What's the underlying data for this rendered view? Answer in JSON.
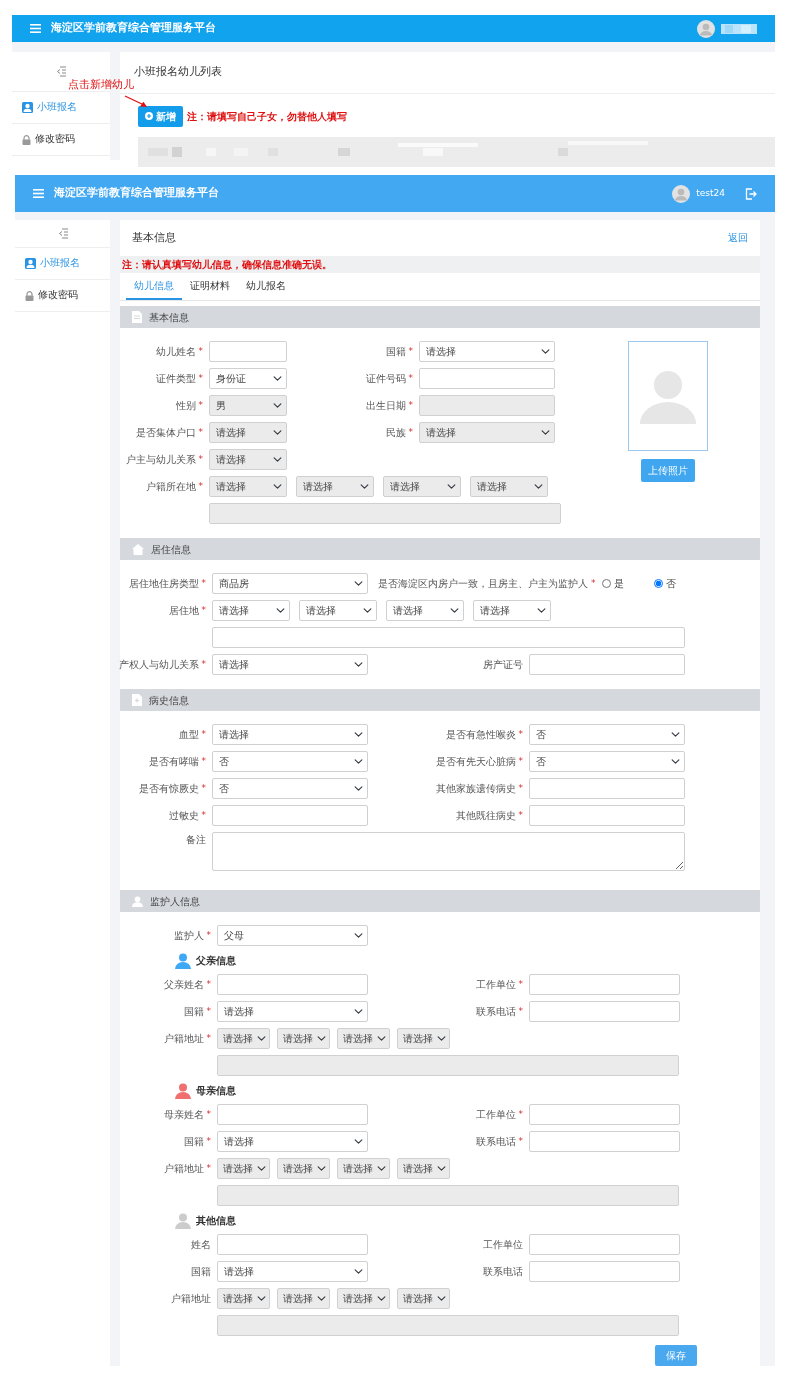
{
  "top_screen": {
    "app_title": "海淀区学前教育综合管理服务平台",
    "sidebar": [
      {
        "label": "小班报名",
        "selected": true
      },
      {
        "label": "修改密码",
        "selected": false
      }
    ],
    "page_title": "小班报名幼儿列表",
    "annotation": "点击新增幼儿",
    "add_button": "新增",
    "note": "注：请填写自己子女，勿替他人填写"
  },
  "form_screen": {
    "app_title": "海淀区学前教育综合管理服务平台",
    "username": "test24",
    "sidebar": [
      {
        "label": "小班报名",
        "selected": true
      },
      {
        "label": "修改密码",
        "selected": false
      }
    ],
    "card_title": "基本信息",
    "back_link": "返回",
    "note": "注：请认真填写幼儿信息，确保信息准确无误。",
    "tabs": [
      {
        "label": "幼儿信息",
        "selected": true
      },
      {
        "label": "证明材料",
        "selected": false
      },
      {
        "label": "幼儿报名",
        "selected": false
      }
    ],
    "sections": [
      {
        "title": "基本信息",
        "photo_button": "上传照片",
        "rows": [
          [
            {
              "kind": "input",
              "label": "幼儿姓名",
              "req": "*",
              "disabled": false
            },
            {
              "kind": "select",
              "label": "国籍",
              "req": "*",
              "value": "请选择",
              "disabled": false
            }
          ],
          [
            {
              "kind": "select",
              "label": "证件类型",
              "req": "*",
              "value": "身份证",
              "disabled": false
            },
            {
              "kind": "input",
              "label": "证件号码",
              "req": "*",
              "disabled": false
            }
          ],
          [
            {
              "kind": "select",
              "label": "性别",
              "req": "*",
              "value": "男",
              "disabled": true
            },
            {
              "kind": "input",
              "label": "出生日期",
              "req": "*",
              "disabled": true
            }
          ],
          [
            {
              "kind": "select",
              "label": "是否集体户口",
              "req": "*",
              "value": "请选择",
              "disabled": true
            },
            {
              "kind": "select",
              "label": "民族",
              "req": "*",
              "value": "请选择",
              "disabled": true
            }
          ],
          [
            {
              "kind": "select",
              "label": "户主与幼儿关系",
              "req": "*",
              "value": "请选择",
              "disabled": true
            }
          ],
          [
            {
              "kind": "address",
              "label": "户籍所在地",
              "req": "*",
              "values": [
                "请选择",
                "请选择",
                "请选择",
                "请选择"
              ],
              "disabled": true
            }
          ],
          [
            {
              "kind": "wide",
              "disabled": true
            }
          ]
        ]
      },
      {
        "title": "居住信息",
        "rows": [
          [
            {
              "kind": "select",
              "label": "居住地住房类型",
              "req": "*",
              "value": "商品房",
              "disabled": false
            },
            {
              "kind": "radio",
              "label": "是否海淀区内房户一致，且房主、户主为监护人",
              "req": "*",
              "choices": [
                {
                  "label": "是",
                  "selected": false
                },
                {
                  "label": "否",
                  "selected": true
                }
              ]
            }
          ],
          [
            {
              "kind": "address",
              "label": "居住地",
              "req": "*",
              "values": [
                "请选择",
                "请选择",
                "请选择",
                "请选择"
              ],
              "disabled": false
            }
          ],
          [
            {
              "kind": "wide",
              "disabled": false
            }
          ],
          [
            {
              "kind": "select",
              "label": "产权人与幼儿关系",
              "req": "*",
              "value": "请选择",
              "disabled": false
            },
            {
              "kind": "input",
              "label": "房产证号",
              "disabled": false
            }
          ]
        ]
      },
      {
        "title": "病史信息",
        "rows": [
          [
            {
              "kind": "select",
              "label": "血型",
              "req": "*",
              "value": "请选择",
              "disabled": false
            },
            {
              "kind": "select",
              "label": "是否有急性喉炎",
              "req": "*",
              "value": "否",
              "disabled": false
            }
          ],
          [
            {
              "kind": "select",
              "label": "是否有哮喘",
              "req": "*",
              "value": "否",
              "disabled": false
            },
            {
              "kind": "select",
              "label": "是否有先天心脏病",
              "req": "*",
              "value": "否",
              "disabled": false
            }
          ],
          [
            {
              "kind": "select",
              "label": "是否有惊厥史",
              "req": "*",
              "value": "否",
              "disabled": false
            },
            {
              "kind": "input",
              "label": "其他家族遗传病史",
              "req": "*",
              "disabled": false
            }
          ],
          [
            {
              "kind": "input",
              "label": "过敏史",
              "req": "*",
              "disabled": false
            },
            {
              "kind": "input",
              "label": "其他既往病史",
              "req": "*",
              "disabled": false
            }
          ],
          [
            {
              "kind": "textarea",
              "label": "备注",
              "disabled": false
            }
          ]
        ]
      },
      {
        "title": "监护人信息",
        "rows": [
          [
            {
              "kind": "select",
              "label": "监护人",
              "req": "*",
              "value": "父母",
              "disabled": false
            }
          ]
        ],
        "groups": [
          {
            "title": "父亲信息",
            "color": "#3fa9f5",
            "rows": [
              [
                {
                  "kind": "input",
                  "label": "父亲姓名",
                  "req": "*",
                  "disabled": false
                },
                {
                  "kind": "input",
                  "label": "工作单位",
                  "req": "*",
                  "disabled": false
                }
              ],
              [
                {
                  "kind": "select",
                  "label": "国籍",
                  "req": "*",
                  "value": "请选择",
                  "disabled": false
                },
                {
                  "kind": "input",
                  "label": "联系电话",
                  "req": "*",
                  "disabled": false
                }
              ],
              [
                {
                  "kind": "address",
                  "label": "户籍地址",
                  "req": "*",
                  "values": [
                    "请选择",
                    "请选择",
                    "请选择",
                    "请选择"
                  ],
                  "disabled": true
                }
              ],
              [
                {
                  "kind": "wide",
                  "disabled": true
                }
              ]
            ]
          },
          {
            "title": "母亲信息",
            "color": "#f07070",
            "rows": [
              [
                {
                  "kind": "input",
                  "label": "母亲姓名",
                  "req": "*",
                  "disabled": false
                },
                {
                  "kind": "input",
                  "label": "工作单位",
                  "req": "*",
                  "disabled": false
                }
              ],
              [
                {
                  "kind": "select",
                  "label": "国籍",
                  "req": "*",
                  "value": "请选择",
                  "disabled": false
                },
                {
                  "kind": "input",
                  "label": "联系电话",
                  "req": "*",
                  "disabled": false
                }
              ],
              [
                {
                  "kind": "address",
                  "label": "户籍地址",
                  "req": "*",
                  "values": [
                    "请选择",
                    "请选择",
                    "请选择",
                    "请选择"
                  ],
                  "disabled": true
                }
              ],
              [
                {
                  "kind": "wide",
                  "disabled": true
                }
              ]
            ]
          },
          {
            "title": "其他信息",
            "color": "#cccccc",
            "rows": [
              [
                {
                  "kind": "input",
                  "label": "姓名",
                  "disabled": false
                },
                {
                  "kind": "input",
                  "label": "工作单位",
                  "disabled": false
                }
              ],
              [
                {
                  "kind": "select",
                  "label": "国籍",
                  "value": "请选择",
                  "disabled": false
                },
                {
                  "kind": "input",
                  "label": "联系电话",
                  "disabled": false
                }
              ],
              [
                {
                  "kind": "address",
                  "label": "户籍地址",
                  "values": [
                    "请选择",
                    "请选择",
                    "请选择",
                    "请选择"
                  ],
                  "disabled": true
                }
              ],
              [
                {
                  "kind": "wide",
                  "disabled": true
                }
              ]
            ]
          }
        ]
      }
    ],
    "save_button": "保存"
  }
}
